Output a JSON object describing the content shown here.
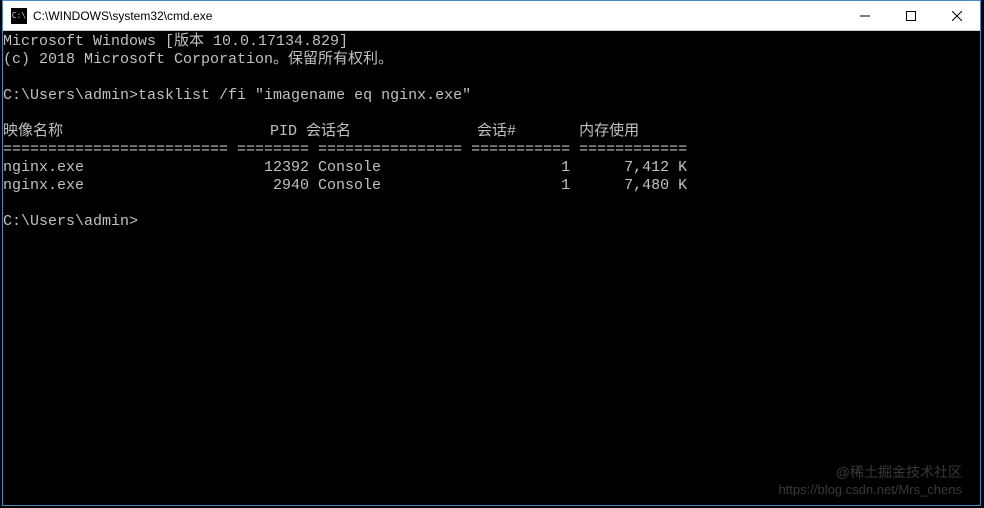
{
  "window": {
    "title": "C:\\WINDOWS\\system32\\cmd.exe",
    "icon_glyph": "C:\\"
  },
  "terminal": {
    "banner1": "Microsoft Windows [版本 10.0.17134.829]",
    "banner2": "(c) 2018 Microsoft Corporation。保留所有权利。",
    "prompt1_path": "C:\\Users\\admin>",
    "prompt1_cmd": "tasklist /fi \"imagename eq nginx.exe\"",
    "header_line": "映像名称                       PID 会话名              会话#       内存使用",
    "separator_line": "========================= ======== ================ =========== ============",
    "row1": "nginx.exe                    12392 Console                    1      7,412 K",
    "row2": "nginx.exe                     2940 Console                    1      7,480 K",
    "prompt2_path": "C:\\Users\\admin>"
  },
  "watermark": {
    "line1": "@稀土掘金技术社区",
    "line2": "https://blog.csdn.net/Mrs_chens"
  }
}
